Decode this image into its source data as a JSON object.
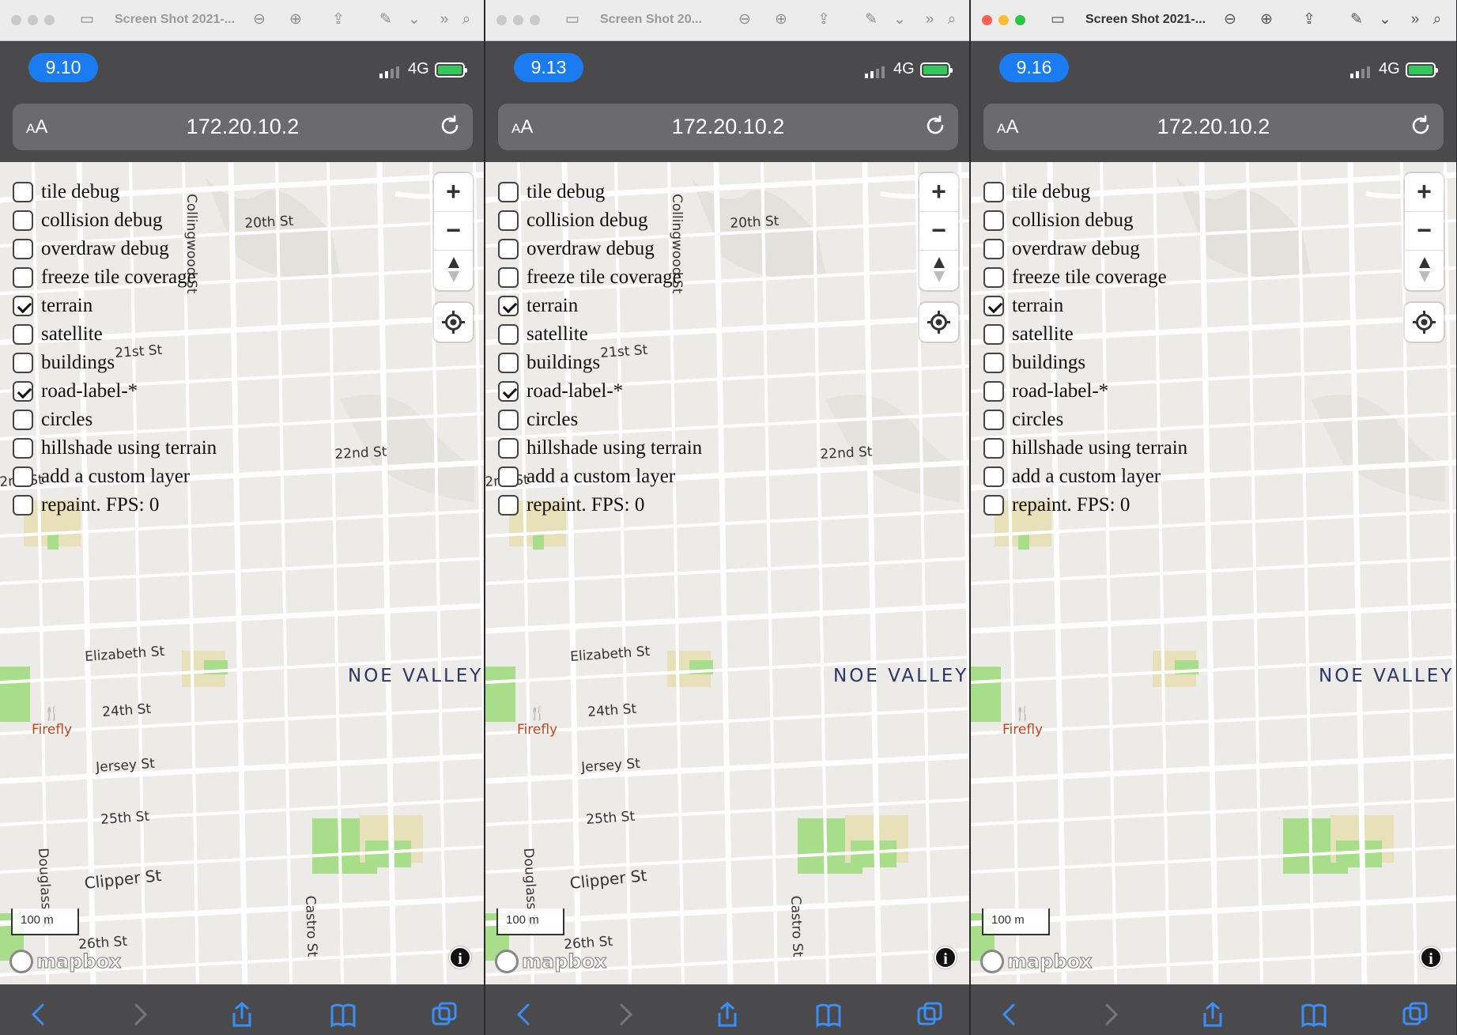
{
  "panels": [
    {
      "window_title": "Screen Shot 2021-...",
      "time": "9.10",
      "network": "4G",
      "url_aa": "AA",
      "url": "172.20.10.2",
      "active": false
    },
    {
      "window_title": "Screen Shot 20...",
      "time": "9.13",
      "network": "4G",
      "url_aa": "AA",
      "url": "172.20.10.2",
      "active": false
    },
    {
      "window_title": "Screen Shot 2021-...",
      "time": "9.16",
      "network": "4G",
      "url_aa": "AA",
      "url": "172.20.10.2",
      "active": true
    }
  ],
  "options": [
    "tile debug",
    "collision debug",
    "overdraw debug",
    "freeze tile coverage",
    "terrain",
    "satellite",
    "buildings",
    "road-label-*",
    "circles",
    "hillshade using terrain",
    "add a custom layer",
    "repaint. FPS: 0"
  ],
  "checked": [
    [
      false,
      false,
      false,
      false,
      true,
      false,
      false,
      true,
      false,
      false,
      false,
      false
    ],
    [
      false,
      false,
      false,
      false,
      true,
      false,
      false,
      true,
      false,
      false,
      false,
      false
    ],
    [
      false,
      false,
      false,
      false,
      true,
      false,
      false,
      false,
      false,
      false,
      false,
      false
    ]
  ],
  "map_labels": {
    "collingwood": "Collingwood St",
    "s20th": "20th St",
    "s21st": "21st St",
    "s22nd": "22nd St",
    "s22nd_clip": "2nd St",
    "elizabeth": "Elizabeth St",
    "s24th": "24th St",
    "jersey": "Jersey St",
    "s25th": "25th St",
    "douglass": "Douglass St",
    "clipper": "Clipper St",
    "castro": "Castro St",
    "s26th": "26th St",
    "neighborhood": "NOE VALLEY",
    "poi": "Firefly",
    "scale": "100 m",
    "logo": "mapbox",
    "info": "i"
  },
  "colors": {
    "time_pill": "#1a7cf0",
    "map_bg": "#ecebe7",
    "park": "#a8dd8a",
    "sand": "#e8e0b8",
    "battery": "#34c759",
    "poi": "#c0461d"
  }
}
